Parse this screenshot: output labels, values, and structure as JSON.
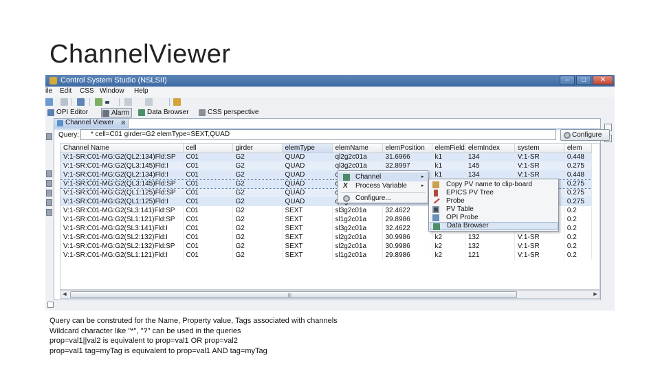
{
  "slide": {
    "title": "ChannelViewer"
  },
  "window": {
    "title": "Control System Studio (NSLSII)",
    "minimize_glyph": "–",
    "maximize_glyph": "□",
    "close_glyph": "✕"
  },
  "menubar": {
    "items": [
      "ile",
      "Edit",
      "CSS",
      "Window",
      "Help"
    ]
  },
  "perspectives": {
    "items": [
      "OPI Editor",
      "Alarm",
      "Data Browser",
      "CSS perspective"
    ]
  },
  "view": {
    "tab_label": "Channel Viewer",
    "tab_close": "⊠",
    "query_label": "Query:",
    "query_value": "* cell=C01 girder=G2 elemType=SEXT,QUAD",
    "query_dropdown_glyph": "▼",
    "configure_label": "Configure",
    "scroll_grip": "|||",
    "scroll_left": "◀",
    "scroll_right": "▶"
  },
  "table": {
    "columns": [
      "Channel Name",
      "cell",
      "girder",
      "elemType",
      "elemName",
      "elemPosition",
      "elemField",
      "elemIndex",
      "system",
      "elem"
    ],
    "rows": [
      [
        "V:1-SR:C01-MG:G2(QL2:134)Fld:SP",
        "C01",
        "G2",
        "QUAD",
        "ql2g2c01a",
        "31.6966",
        "k1",
        "134",
        "V:1-SR",
        "0.448"
      ],
      [
        "V:1-SR:C01-MG:G2(QL3:145)Fld:I",
        "C01",
        "G2",
        "QUAD",
        "ql3g2c01a",
        "32.8997",
        "k1",
        "145",
        "V:1-SR",
        "0.275"
      ],
      [
        "V:1-SR:C01-MG:G2(QL2:134)Fld:I",
        "C01",
        "G2",
        "QUAD",
        "q",
        "",
        "k1",
        "134",
        "V:1-SR",
        "0.448"
      ],
      [
        "V:1-SR:C01-MG:G2(QL3:145)Fld:SP",
        "C01",
        "G2",
        "QUAD",
        "q",
        "",
        "",
        "",
        "",
        "0.275"
      ],
      [
        "V:1-SR:C01-MG:G2(QL1:125)Fld:SP",
        "C01",
        "G2",
        "QUAD",
        "q",
        "",
        "",
        "",
        "",
        "0.275"
      ],
      [
        "V:1-SR:C01-MG:G2(QL1:125)Fld:I",
        "C01",
        "G2",
        "QUAD",
        "ql1g2c01a",
        "30.5501",
        "",
        "",
        "",
        "0.275"
      ],
      [
        "V:1-SR:C01-MG:G2(SL3:141)Fld:SP",
        "C01",
        "G2",
        "SEXT",
        "sl3g2c01a",
        "32.4622",
        "",
        "",
        "",
        "0.2"
      ],
      [
        "V:1-SR:C01-MG:G2(SL1:121)Fld:SP",
        "C01",
        "G2",
        "SEXT",
        "sl1g2c01a",
        "29.8986",
        "",
        "",
        "",
        "0.2"
      ],
      [
        "V:1-SR:C01-MG:G2(SL3:141)Fld:I",
        "C01",
        "G2",
        "SEXT",
        "sl3g2c01a",
        "32.4622",
        "",
        "",
        "",
        "0.2"
      ],
      [
        "V:1-SR:C01-MG:G2(SL2:132)Fld:I",
        "C01",
        "G2",
        "SEXT",
        "sl2g2c01a",
        "30.9986",
        "k2",
        "132",
        "V:1-SR",
        "0.2"
      ],
      [
        "V:1-SR:C01-MG:G2(SL2:132)Fld:SP",
        "C01",
        "G2",
        "SEXT",
        "sl2g2c01a",
        "30.9986",
        "k2",
        "132",
        "V:1-SR",
        "0.2"
      ],
      [
        "V:1-SR:C01-MG:G2(SL1:121)Fld:I",
        "C01",
        "G2",
        "SEXT",
        "sl1g2c01a",
        "29.8986",
        "k2",
        "121",
        "V:1-SR",
        "0.2"
      ]
    ]
  },
  "context_menu": {
    "items": [
      {
        "label": "Channel",
        "icon": "channel-icon",
        "submenu": true
      },
      {
        "label": "Process Variable",
        "icon": "process-variable-icon",
        "submenu": true
      },
      {
        "label": "Configure...",
        "icon": "gear-icon",
        "submenu": false
      }
    ],
    "arrow_glyph": "▸",
    "process_variable_glyph": "X",
    "submenu": [
      {
        "label": "Copy PV name to clip-board",
        "icon": "clipboard-icon"
      },
      {
        "label": "EPICS PV Tree",
        "icon": "pv-tree-icon"
      },
      {
        "label": "Probe",
        "icon": "probe-icon"
      },
      {
        "label": "PV Table",
        "icon": "pv-table-icon"
      },
      {
        "label": "OPI Probe",
        "icon": "opi-probe-icon"
      },
      {
        "label": "Data Browser",
        "icon": "data-browser-icon"
      }
    ]
  },
  "notes": [
    "Query can be construted for the Name, Property value, Tags associated with channels",
    "Wildcard character like \"*\", \"?\" can be used in the queries",
    "prop=val1||val2 is equivalent to prop=val1 OR prop=val2",
    "prop=val1 tag=myTag is equivalent to prop=val1 AND tag=myTag"
  ],
  "colors": {
    "titlebar": "#3d6aa3",
    "selection": "#dce8f7",
    "menu_highlight": "#d3e0f1"
  }
}
